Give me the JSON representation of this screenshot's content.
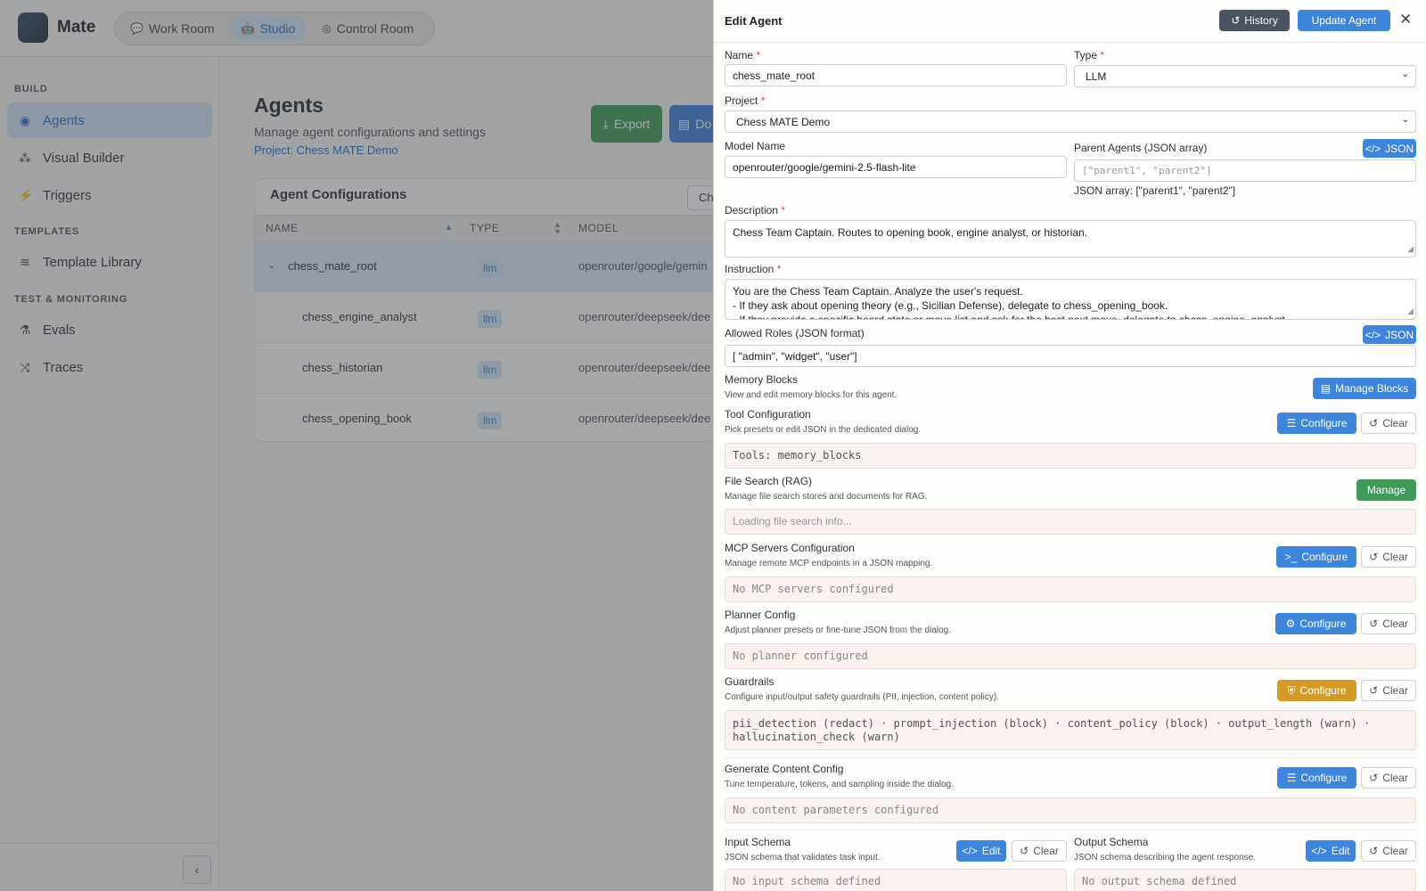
{
  "app": {
    "name": "Mate",
    "nav_tabs": [
      {
        "label": "Work Room",
        "icon": "chat-icon"
      },
      {
        "label": "Studio",
        "icon": "robot-icon"
      },
      {
        "label": "Control Room",
        "icon": "dashboard-icon"
      }
    ]
  },
  "sidebar": {
    "sections": [
      {
        "title": "BUILD",
        "items": [
          {
            "label": "Agents",
            "icon": "robot-icon"
          },
          {
            "label": "Visual Builder",
            "icon": "network-icon"
          },
          {
            "label": "Triggers",
            "icon": "bolt-icon"
          }
        ]
      },
      {
        "title": "TEMPLATES",
        "items": [
          {
            "label": "Template Library",
            "icon": "layers-icon"
          }
        ]
      },
      {
        "title": "TEST & MONITORING",
        "items": [
          {
            "label": "Evals",
            "icon": "flask-icon"
          },
          {
            "label": "Traces",
            "icon": "share-icon"
          }
        ]
      }
    ],
    "collapse_icon": "chevron-left-icon"
  },
  "main": {
    "title": "Agents",
    "subtitle": "Manage agent configurations and settings",
    "project": "Project: Chess MATE Demo",
    "export_label": "Export",
    "download_label": "Do",
    "card_title": "Agent Configurations",
    "card_search": "Ch",
    "columns": [
      "NAME",
      "TYPE",
      "MODEL"
    ],
    "rows": [
      {
        "name": "chess_mate_root",
        "type": "llm",
        "model": "openrouter/google/gemin"
      },
      {
        "name": "chess_engine_analyst",
        "type": "llm",
        "model": "openrouter/deepseek/dee"
      },
      {
        "name": "chess_historian",
        "type": "llm",
        "model": "openrouter/deepseek/dee"
      },
      {
        "name": "chess_opening_book",
        "type": "llm",
        "model": "openrouter/deepseek/dee"
      }
    ]
  },
  "drawer": {
    "title": "Edit Agent",
    "history_label": "History",
    "update_label": "Update Agent",
    "name_label": "Name",
    "name_value": "chess_mate_root",
    "type_label": "Type",
    "type_value": "LLM",
    "project_label": "Project",
    "project_value": "Chess MATE Demo",
    "model_label": "Model Name",
    "model_value": "openrouter/google/gemini-2.5-flash-lite",
    "parent_label": "Parent Agents (JSON array)",
    "parent_placeholder": "[\"parent1\", \"parent2\"]",
    "parent_hint": "JSON array: [\"parent1\", \"parent2\"]",
    "json_label": "JSON",
    "description_label": "Description",
    "description_value": "Chess Team Captain. Routes to opening book, engine analyst, or historian.",
    "instruction_label": "Instruction",
    "instruction_lines": [
      "You are the Chess Team Captain. Analyze the user's request.",
      "- If they ask about opening theory (e.g., Sicilian Defense), delegate to chess_opening_book.",
      "- If they provide a specific board state or move list and ask for the best next move, delegate to chess_engine_analyst."
    ],
    "roles_label": "Allowed Roles (JSON format)",
    "roles_value": "[ \"admin\", \"widget\", \"user\"]",
    "memory": {
      "title": "Memory Blocks",
      "hint": "View and edit memory blocks for this agent.",
      "button": "Manage Blocks"
    },
    "tools": {
      "title": "Tool Configuration",
      "hint": "Pick presets or edit JSON in the dedicated dialog.",
      "configure": "Configure",
      "clear": "Clear",
      "preview": "Tools: memory_blocks"
    },
    "file_search": {
      "title": "File Search (RAG)",
      "hint": "Manage file search stores and documents for RAG.",
      "button": "Manage",
      "preview": "Loading file search info..."
    },
    "mcp": {
      "title": "MCP Servers Configuration",
      "hint": "Manage remote MCP endpoints in a JSON mapping.",
      "configure": "Configure",
      "clear": "Clear",
      "preview": "No MCP servers configured"
    },
    "planner": {
      "title": "Planner Config",
      "hint": "Adjust planner presets or fine-tune JSON from the dialog.",
      "configure": "Configure",
      "clear": "Clear",
      "preview": "No planner configured"
    },
    "guardrails": {
      "title": "Guardrails",
      "hint": "Configure input/output safety guardrails (PII, injection, content policy).",
      "configure": "Configure",
      "clear": "Clear",
      "preview_line1": "pii_detection (redact) · prompt_injection (block) · content_policy (block) · output_length (warn) ·",
      "preview_line2": "hallucination_check (warn)"
    },
    "gencontent": {
      "title": "Generate Content Config",
      "hint": "Tune temperature, tokens, and sampling inside the dialog.",
      "configure": "Configure",
      "clear": "Clear",
      "preview": "No content parameters configured"
    },
    "input_schema": {
      "title": "Input Schema",
      "hint": "JSON schema that validates task input.",
      "edit": "Edit",
      "clear": "Clear",
      "preview": "No input schema defined"
    },
    "output_schema": {
      "title": "Output Schema",
      "hint": "JSON schema describing the agent response.",
      "edit": "Edit",
      "clear": "Clear",
      "preview": "No output schema defined"
    }
  },
  "colors": {
    "primary": "#3d85dd",
    "success": "#3e9a57",
    "warning": "#d49a28",
    "dark": "#4b5260"
  }
}
